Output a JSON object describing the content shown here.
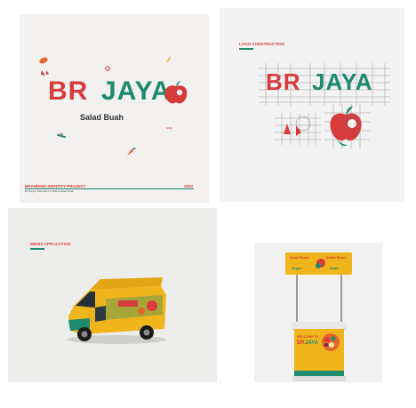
{
  "brand": {
    "part1": "BR",
    "part2": "JAYA"
  },
  "panel_cover": {
    "subtitle": "Salad Buah",
    "signature": "Sqfig",
    "footer_title": "BRANDING IDENTITY PROJECT",
    "footer_sub": "By Reyne Nouvelle for Brand Salad Buah",
    "footer_year": "2023"
  },
  "panel_construction": {
    "heading": "LOGO CONSTRUCTION"
  },
  "panel_media": {
    "heading": "MEDIA APPLICATION"
  },
  "panel_booth": {
    "sign_left_top": "Salad Buah",
    "sign_left_bottom": "Segar",
    "sign_right_top": "Salad Buah",
    "sign_right_bottom": "Enak",
    "welcome": "WELCOME TO"
  },
  "colors": {
    "red": "#d63c3c",
    "green": "#1e8a6e",
    "yellow": "#f1b51c"
  },
  "icons": [
    "apple-icon",
    "strawberry-icon",
    "grape-icon",
    "banana-icon"
  ]
}
